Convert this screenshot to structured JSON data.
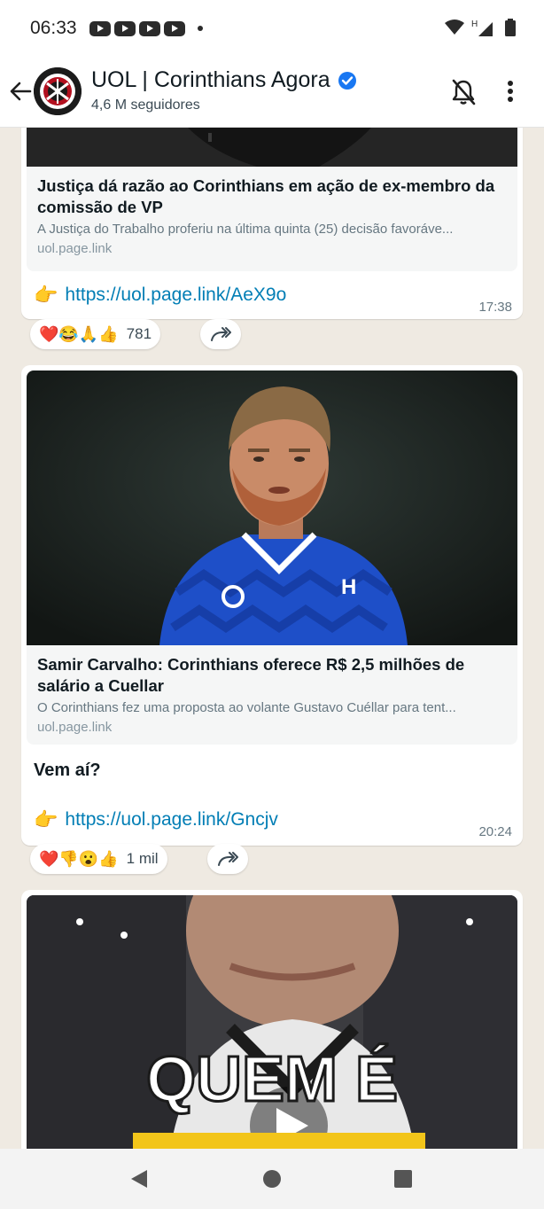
{
  "status_bar": {
    "time": "06:33"
  },
  "header": {
    "channel_name": "UOL | Corinthians Agora",
    "followers": "4,6 M seguidores"
  },
  "posts": [
    {
      "card_title": "Justiça dá razão ao Corinthians em ação de ex-membro da comissão de VP",
      "card_desc": "A Justiça do Trabalho proferiu na última quinta (25) decisão favoráve...",
      "card_domain": "uol.page.link",
      "link": "https://uol.page.link/AeX9o",
      "time": "17:38",
      "reactions": "❤️😂🙏👍",
      "reaction_count": "781"
    },
    {
      "card_title": "Samir Carvalho: Corinthians oferece R$ 2,5 milhões de salário a Cuellar",
      "card_desc": "O Corinthians fez uma proposta ao volante Gustavo Cuéllar para tent...",
      "card_domain": "uol.page.link",
      "message": "Vem aí?",
      "link": "https://uol.page.link/Gncjv",
      "time": "20:24",
      "reactions": "❤️👎😮👍",
      "reaction_count": "1 mil"
    },
    {
      "video_overlay_text": "QUEM É"
    }
  ],
  "colors": {
    "link": "#027eb5",
    "verified": "#1877f2",
    "chat_bg": "#efeae2",
    "jersey": "#1e4fc8"
  }
}
